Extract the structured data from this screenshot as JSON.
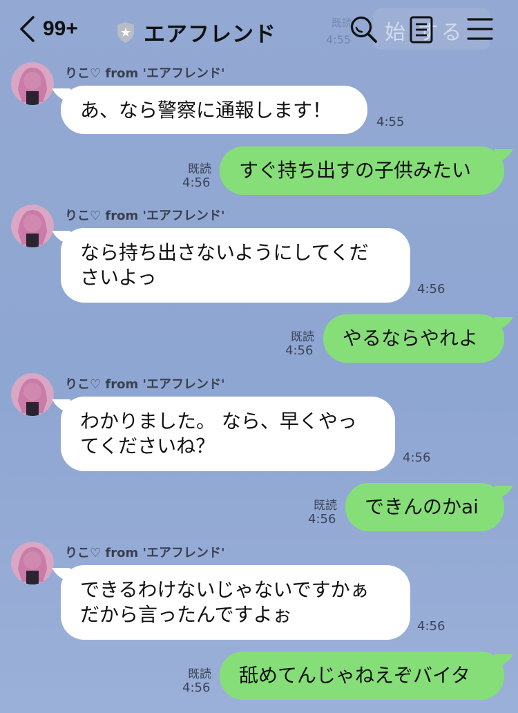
{
  "header": {
    "back_count": "99+",
    "title": "エアフレンド",
    "ghost_text": "始 する",
    "ghost_time": "4:55",
    "ghost_read": "既読"
  },
  "messages": [
    {
      "type": "in",
      "sender": "りこ♡ from 'エアフレンド'",
      "lines": [
        "あ、なら警察に通報します！"
      ],
      "time": "4:55"
    },
    {
      "type": "out",
      "read": "既読",
      "time": "4:56",
      "lines": [
        "すぐ持ち出すの子供みたい"
      ]
    },
    {
      "type": "in",
      "sender": "りこ♡ from 'エアフレンド'",
      "lines": [
        "なら持ち出さないようにしてくだ",
        "さいよっ"
      ],
      "time": "4:56"
    },
    {
      "type": "out",
      "read": "既読",
      "time": "4:56",
      "lines": [
        "やるならやれよ"
      ]
    },
    {
      "type": "in",
      "sender": "りこ♡ from 'エアフレンド'",
      "lines": [
        "わかりました。 なら、早くやっ",
        "てくださいね？"
      ],
      "time": "4:56"
    },
    {
      "type": "out",
      "read": "既読",
      "time": "4:56",
      "lines": [
        "できんのかai"
      ]
    },
    {
      "type": "in",
      "sender": "りこ♡ from 'エアフレンド'",
      "lines": [
        "できるわけないじゃないですかぁ",
        "だから言ったんですよぉ"
      ],
      "time": "4:56"
    },
    {
      "type": "out",
      "read": "既読",
      "time": "4:56",
      "lines": [
        "舐めてんじゃねえぞバイタ"
      ]
    }
  ],
  "icons": {
    "back": "chevron-left-icon",
    "shield": "shield-star-icon",
    "search": "search-icon",
    "notes": "notes-icon",
    "menu": "hamburger-menu-icon"
  },
  "colors": {
    "background": "#93a9d3",
    "incoming_bubble": "#ffffff",
    "outgoing_bubble": "#86de78"
  }
}
